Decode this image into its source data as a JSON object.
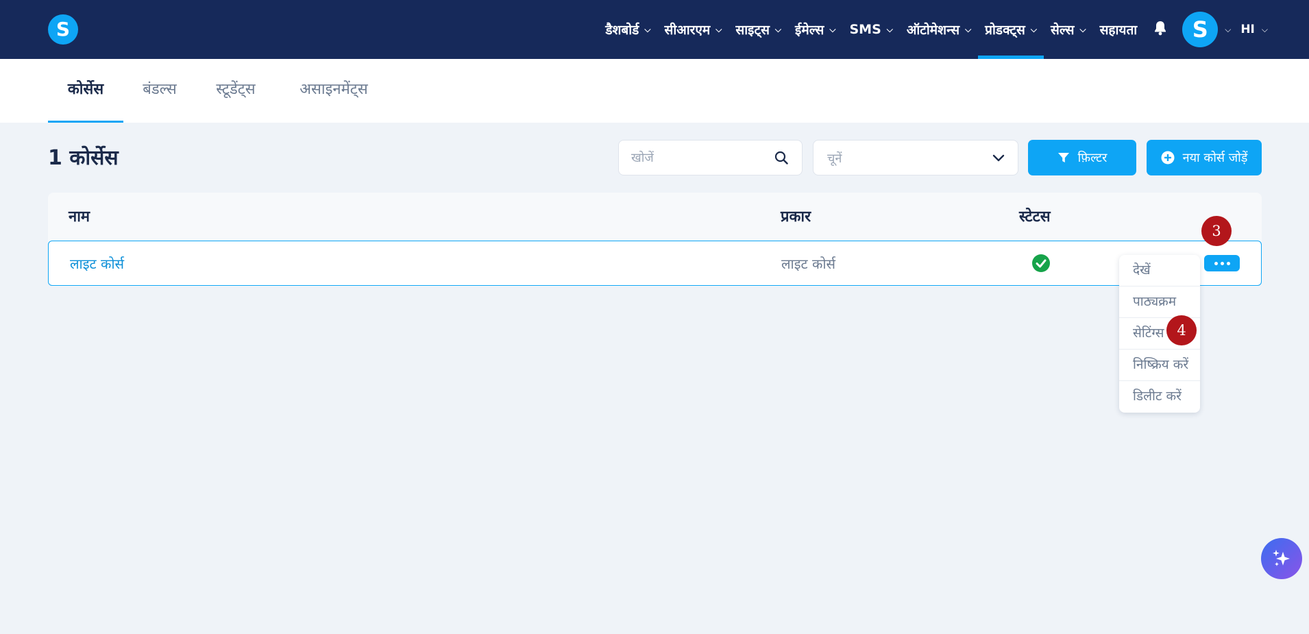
{
  "header": {
    "logo_letter": "S",
    "nav": [
      {
        "label": "डैशबोर्ड",
        "icon": "chevron-down-icon"
      },
      {
        "label": "सीआरएम",
        "icon": "chevron-down-icon"
      },
      {
        "label": "साइट्स",
        "icon": "chevron-down-icon"
      },
      {
        "label": "ईमेल्स",
        "icon": "chevron-down-icon"
      },
      {
        "label": "SMS",
        "icon": "chevron-down-icon"
      },
      {
        "label": "ऑटोमेशन्स",
        "icon": "chevron-down-icon"
      },
      {
        "label": "प्रोडक्ट्स",
        "icon": "chevron-down-icon",
        "active": true
      },
      {
        "label": "सेल्स",
        "icon": "chevron-down-icon"
      },
      {
        "label": "सहायता"
      }
    ],
    "notification_icon": "bell-icon",
    "avatar_letter": "S",
    "language": "HI"
  },
  "tabs": [
    {
      "label": "कोर्सेस",
      "active": true
    },
    {
      "label": "बंडल्स"
    },
    {
      "label": "स्टूडेंट्स"
    },
    {
      "label": "असाइनमेंट्स"
    }
  ],
  "toolbar": {
    "count_title": "1 कोर्सेस",
    "search_placeholder": "खोजें",
    "select_placeholder": "चूनें",
    "filter_label": "फ़िल्टर",
    "add_label": "नया कोर्स जोड़ें"
  },
  "table": {
    "columns": [
      "नाम",
      "प्रकार",
      "स्टेटस"
    ],
    "rows": [
      {
        "name": "लाइट कोर्स",
        "type": "लाइट कोर्स",
        "status": "active"
      }
    ]
  },
  "row_menu": {
    "items": [
      "देखें",
      "पाठ्यक्रम",
      "सेटिंग्स",
      "निष्क्रिय करें",
      "डिलीट करें"
    ]
  },
  "step_badges": [
    "3",
    "4"
  ],
  "colors": {
    "nav_bg": "#16295a",
    "accent": "#0ea5f5",
    "status_green": "#16a34a",
    "badge_red": "#b3161b"
  }
}
